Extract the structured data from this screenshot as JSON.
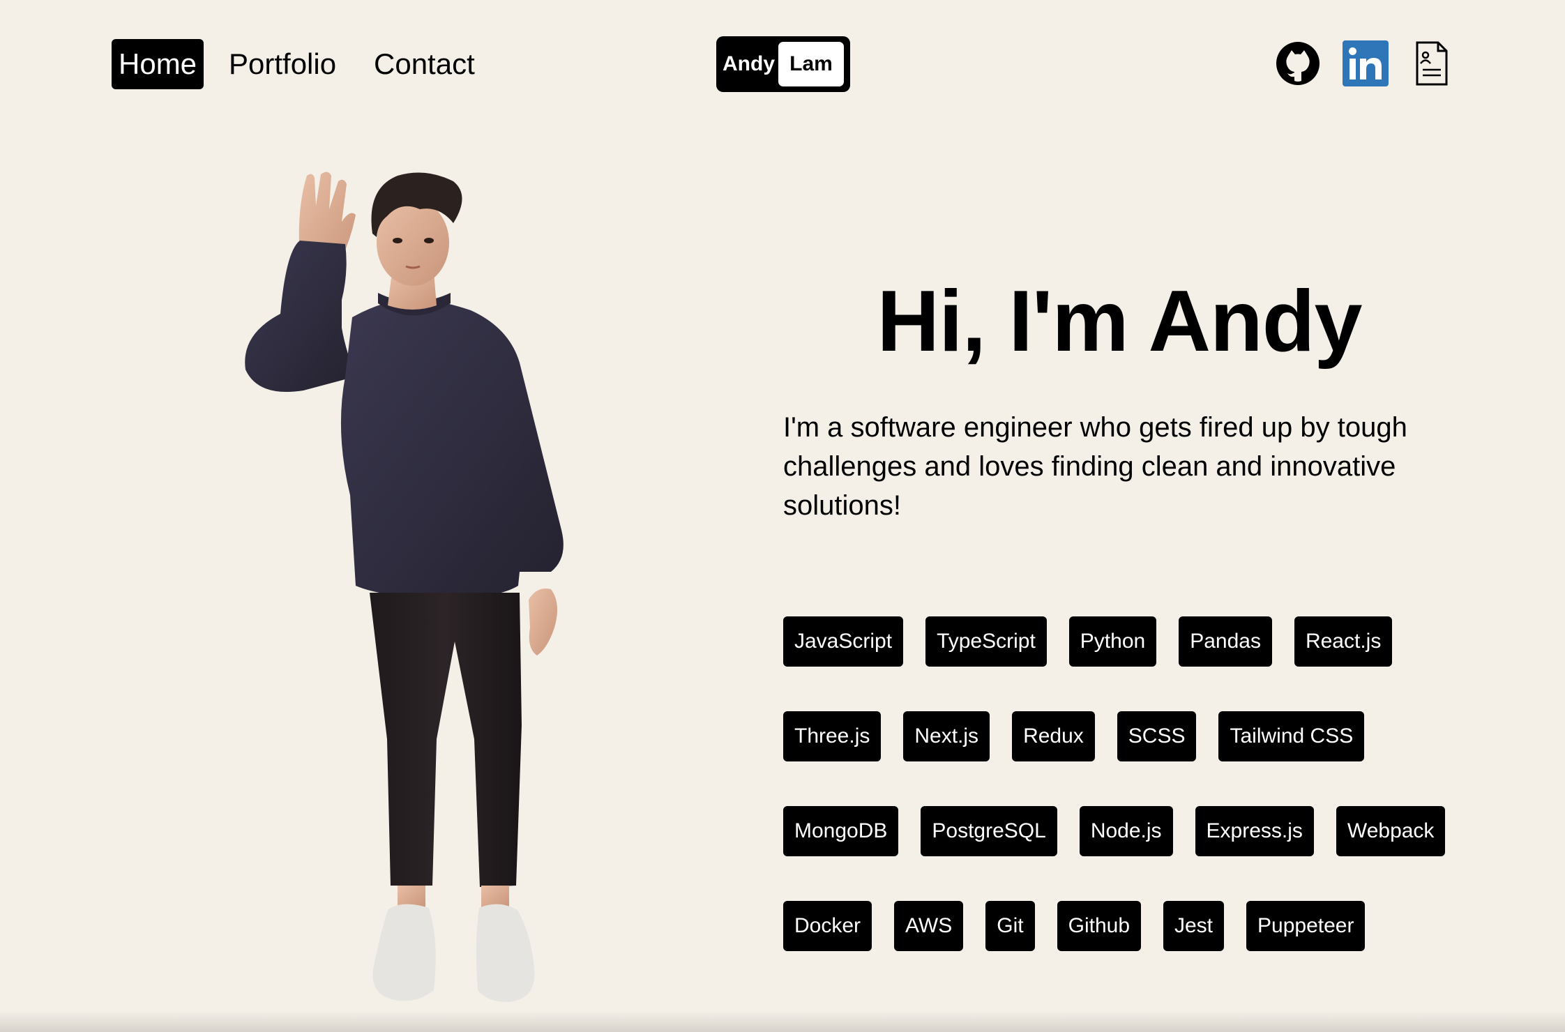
{
  "nav": {
    "home": "Home",
    "portfolio": "Portfolio",
    "contact": "Contact",
    "active": "home"
  },
  "logo": {
    "first": "Andy",
    "last": "Lam"
  },
  "social": [
    {
      "icon": "github-icon"
    },
    {
      "icon": "linkedin-icon",
      "text": "in",
      "color": "#2e76b8"
    },
    {
      "icon": "resume-icon"
    }
  ],
  "hero": {
    "title": "Hi, I'm Andy",
    "description": "I'm a software engineer who gets fired up by tough challenges and loves finding clean and innovative solutions!"
  },
  "skills": [
    "JavaScript",
    "TypeScript",
    "Python",
    "Pandas",
    "React.js",
    "Three.js",
    "Next.js",
    "Redux",
    "SCSS",
    "Tailwind CSS",
    "MongoDB",
    "PostgreSQL",
    "Node.js",
    "Express.js",
    "Webpack",
    "Docker",
    "AWS",
    "Git",
    "Github",
    "Jest",
    "Puppeteer"
  ],
  "colors": {
    "background": "#f4f0e8",
    "accent": "#000000",
    "linkedin": "#2e76b8"
  }
}
